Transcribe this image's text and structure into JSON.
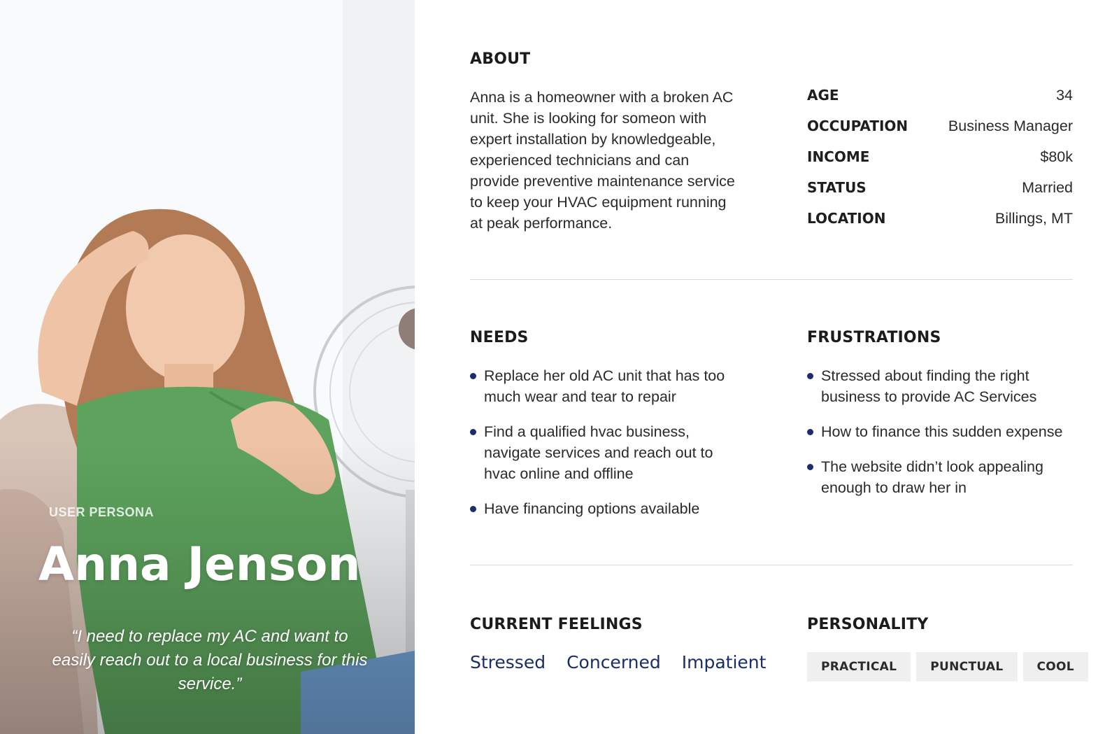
{
  "persona": {
    "label": "USER PERSONA",
    "name": "Anna Jenson",
    "quote": "“I need to replace my AC and want to easily reach out to a local business for this service.”"
  },
  "about": {
    "heading": "ABOUT",
    "text": "Anna is a homeowner with a broken AC unit. She is looking for someon with expert installation by knowledgeable, experienced technicians and can provide preventive maintenance service to keep your HVAC equipment running at peak performance.",
    "facts": [
      {
        "key": "AGE",
        "value": "34"
      },
      {
        "key": "OCCUPATION",
        "value": "Business Manager"
      },
      {
        "key": "INCOME",
        "value": "$80k"
      },
      {
        "key": "STATUS",
        "value": "Married"
      },
      {
        "key": "LOCATION",
        "value": "Billings, MT"
      }
    ]
  },
  "needs": {
    "heading": "NEEDS",
    "items": [
      "Replace her old AC unit that has too much wear and tear to repair",
      "Find a qualified hvac business, navigate services and reach out to hvac online and offline",
      "Have financing options available"
    ]
  },
  "frustrations": {
    "heading": "FRUSTRATIONS",
    "items": [
      "Stressed about finding the right business to provide AC Services",
      "How to finance this sudden expense",
      "The website didn’t look appealing enough to draw her in"
    ]
  },
  "feelings": {
    "heading": "CURRENT FEELINGS",
    "items": [
      "Stressed",
      "Concerned",
      "Impatient"
    ]
  },
  "personality": {
    "heading": "PERSONALITY",
    "tags": [
      "PRACTICAL",
      "PUNCTUAL",
      "COOL"
    ]
  },
  "colors": {
    "accent_navy": "#1a2e66",
    "shirt_green": "#5da35d",
    "tag_bg": "#efefef"
  },
  "image": {
    "icon": "persona-photo-woman-with-fan"
  }
}
